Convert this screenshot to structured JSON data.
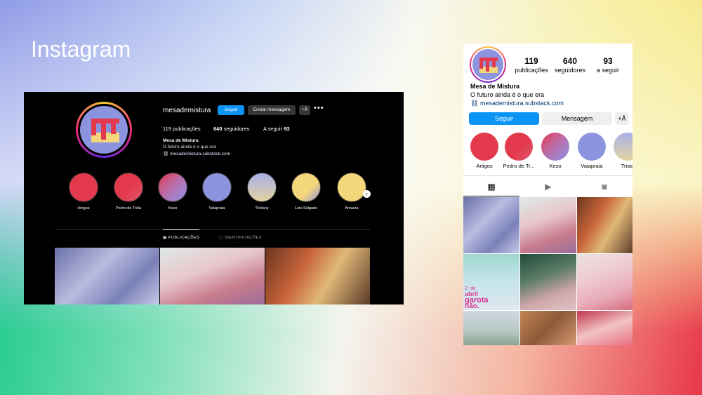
{
  "slide": {
    "title": "Instagram"
  },
  "desktop": {
    "username": "mesademistura",
    "follow_label": "Seguir",
    "message_label": "Enviar mensagem",
    "add_user_glyph": "+Å",
    "more_glyph": "•••",
    "stats": {
      "posts_value": "119",
      "posts_label": "publicações",
      "followers_value": "640",
      "followers_label": "seguidores",
      "following_label": "A seguir",
      "following_value": "93"
    },
    "name": "Mesa de Mistura",
    "bio": "O futuro ainda é o que era",
    "link": "mesademistura.substack.com",
    "highlights": [
      {
        "label": "Artigos"
      },
      {
        "label": "Pedro de Tróia"
      },
      {
        "label": "Keso"
      },
      {
        "label": "Vaiapraia"
      },
      {
        "label": "Tristany"
      },
      {
        "label": "Luís Salgado"
      },
      {
        "label": "Amaura"
      }
    ],
    "tabs": {
      "posts": "PUBLICAÇÕES",
      "tagged": "IDENTIFICAÇÕES"
    }
  },
  "mobile": {
    "stats": [
      {
        "value": "119",
        "label": "publicações"
      },
      {
        "value": "640",
        "label": "seguidores"
      },
      {
        "value": "93",
        "label": "a seguir"
      }
    ],
    "name": "Mesa de Mistura",
    "bio": "O futuro ainda é o que era",
    "link": "mesademistura.substack.com",
    "follow_label": "Seguir",
    "message_label": "Mensagem",
    "highlights": [
      {
        "label": "Artigos"
      },
      {
        "label": "Pedro de Tr..."
      },
      {
        "label": "Keso"
      },
      {
        "label": "Vaiapraia"
      },
      {
        "label": "Trista"
      }
    ],
    "post_text": {
      "line1": "2",
      "line2": "de",
      "line3": "abril",
      "line4": "garota",
      "line5": "não."
    }
  },
  "colors": {
    "follow_blue": "#0a95f6",
    "brand_red": "#e23a4c",
    "brand_yellow": "#f5d77b",
    "brand_lilac": "#8c93df"
  }
}
